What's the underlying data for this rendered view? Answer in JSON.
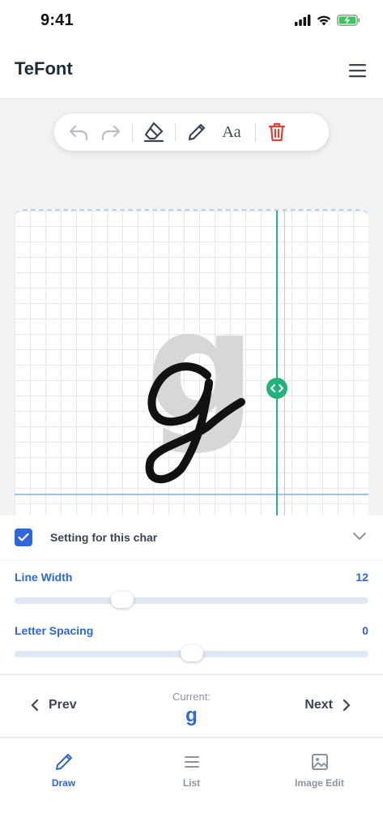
{
  "status_bar": {
    "time": "9:41"
  },
  "header": {
    "title": "TeFont"
  },
  "toolbar": {
    "font_label": "Aa"
  },
  "canvas": {
    "ghost_char": "g"
  },
  "settings": {
    "char_setting_label": "Setting for this char",
    "char_setting_checked": true,
    "line_width": {
      "label": "Line Width",
      "value": "12",
      "fraction": 0.29
    },
    "letter_spacing": {
      "label": "Letter Spacing",
      "value": "0",
      "fraction": 0.5
    }
  },
  "char_nav": {
    "prev_label": "Prev",
    "next_label": "Next",
    "current_label": "Current:",
    "current_char": "g"
  },
  "tabs": [
    {
      "label": "Draw",
      "icon": "pencil-icon",
      "active": true
    },
    {
      "label": "List",
      "icon": "list-icon",
      "active": false
    },
    {
      "label": "Image Edit",
      "icon": "image-icon",
      "active": false
    }
  ],
  "colors": {
    "accent": "#2d67d8",
    "guide_green": "#22b37b",
    "delete_red": "#e0403a"
  }
}
